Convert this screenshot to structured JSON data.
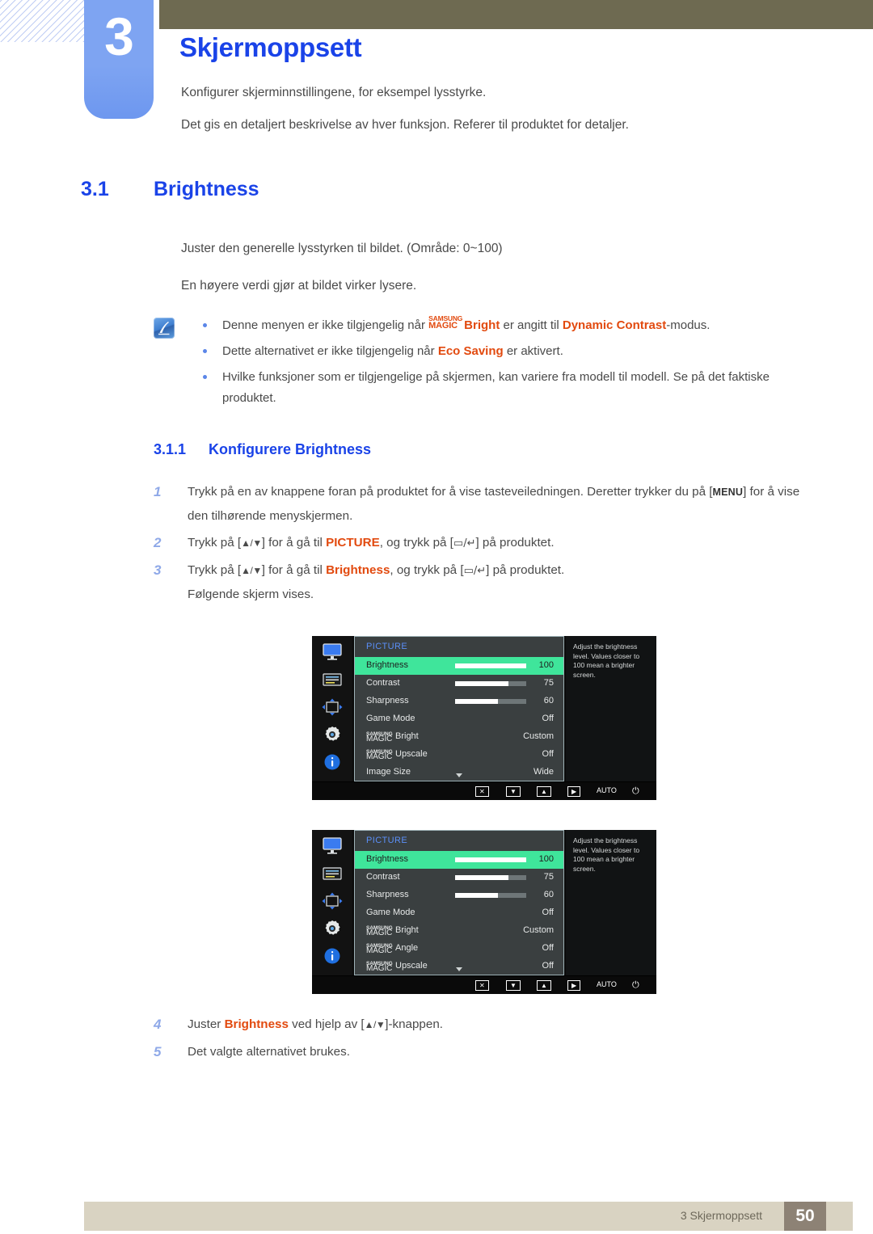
{
  "chapter": {
    "number": "3",
    "title": "Skjermoppsett",
    "desc1": "Konfigurer skjerminnstillingene, for eksempel lysstyrke.",
    "desc2": "Det gis en detaljert beskrivelse av hver funksjon. Referer til produktet for detaljer."
  },
  "section": {
    "number": "3.1",
    "title": "Brightness",
    "para1": "Juster den generelle lysstyrken til bildet. (Område: 0~100)",
    "para2": "En høyere verdi gjør at bildet virker lysere."
  },
  "note": {
    "icon": "note-pen-icon",
    "bullets": [
      {
        "pre": "Denne menyen er ikke tilgjengelig når ",
        "magic_top": "SAMSUNG",
        "magic_bottom": "MAGIC",
        "magic_suffix": "Bright",
        "mid": " er angitt til ",
        "highlight": "Dynamic Contrast",
        "post": "-modus."
      },
      {
        "pre": "Dette alternativet er ikke tilgjengelig når ",
        "highlight": "Eco Saving",
        "post": " er aktivert."
      },
      {
        "pre": "Hvilke funksjoner som er tilgjengelige på skjermen, kan variere fra modell til modell. Se på det faktiske produktet."
      }
    ]
  },
  "subsection": {
    "number": "3.1.1",
    "title": "Konfigurere Brightness"
  },
  "steps": [
    {
      "num": "1",
      "pre": "Trykk på en av knappene foran på produktet for å vise tasteveiledningen. Deretter trykker du på [",
      "key": "MENU",
      "post": "] for å vise den tilhørende menyskjermen."
    },
    {
      "num": "2",
      "pre": "Trykk på [",
      "keys1": "▲/▼",
      "mid1": "] for å gå til ",
      "highlight": "PICTURE",
      "mid2": ", og trykk på [",
      "keys2": "▭/↵",
      "post": "] på produktet."
    },
    {
      "num": "3",
      "pre": "Trykk på [",
      "keys1": "▲/▼",
      "mid1": "] for å gå til ",
      "highlight": "Brightness",
      "mid2": ", og trykk på [",
      "keys2": "▭/↵",
      "post": "] på produktet.",
      "extra": "Følgende skjerm vises."
    },
    {
      "num": "4",
      "pre": "Juster ",
      "highlight": "Brightness",
      "mid1": " ved hjelp av [",
      "keys1": "▲/▼",
      "post": "]-knappen."
    },
    {
      "num": "5",
      "pre": "Det valgte alternativet brukes."
    }
  ],
  "osd": {
    "rail_icons": [
      "monitor-icon",
      "osd-panel-icon",
      "move-arrows-icon",
      "gear-icon",
      "info-icon"
    ],
    "title": "PICTURE",
    "help_text": "Adjust the brightness level. Values closer to 100 mean a brighter screen.",
    "caret": "scroll-down-caret",
    "bottom_keys": {
      "close": "✕",
      "down": "▼",
      "up": "▲",
      "right": "▶",
      "auto": "AUTO",
      "power": "⏻"
    },
    "menu1": {
      "rows": [
        {
          "label": "Brightness",
          "value": "100",
          "slider": 100,
          "selected": true
        },
        {
          "label": "Contrast",
          "value": "75",
          "slider": 75,
          "selected": false
        },
        {
          "label": "Sharpness",
          "value": "60",
          "slider": 60,
          "selected": false
        },
        {
          "label": "Game Mode",
          "value": "Off",
          "selected": false
        },
        {
          "magic_top": "SAMSUNG",
          "magic_bottom": "MAGIC",
          "label": "Bright",
          "value": "Custom",
          "selected": false
        },
        {
          "magic_top": "SAMSUNG",
          "magic_bottom": "MAGIC",
          "label": "Upscale",
          "value": "Off",
          "selected": false
        },
        {
          "label": "Image Size",
          "value": "Wide",
          "selected": false
        }
      ]
    },
    "menu2": {
      "rows": [
        {
          "label": "Brightness",
          "value": "100",
          "slider": 100,
          "selected": true
        },
        {
          "label": "Contrast",
          "value": "75",
          "slider": 75,
          "selected": false
        },
        {
          "label": "Sharpness",
          "value": "60",
          "slider": 60,
          "selected": false
        },
        {
          "label": "Game Mode",
          "value": "Off",
          "selected": false
        },
        {
          "magic_top": "SAMSUNG",
          "magic_bottom": "MAGIC",
          "label": "Bright",
          "value": "Custom",
          "selected": false
        },
        {
          "magic_top": "SAMSUNG",
          "magic_bottom": "MAGIC",
          "label": "Angle",
          "value": "Off",
          "selected": false
        },
        {
          "magic_top": "SAMSUNG",
          "magic_bottom": "MAGIC",
          "label": "Upscale",
          "value": "Off",
          "selected": false
        }
      ]
    }
  },
  "footer": {
    "label": "3 Skjermoppsett",
    "page": "50"
  },
  "colors": {
    "heading_blue": "#1a43e8",
    "badge_blue": "#7ea4f2",
    "olive": "#6e6a51",
    "orange": "#e24a0f",
    "osd_green": "#3fe59b",
    "footer_beige": "#d9d3c2",
    "footer_taupe": "#8d8275"
  }
}
